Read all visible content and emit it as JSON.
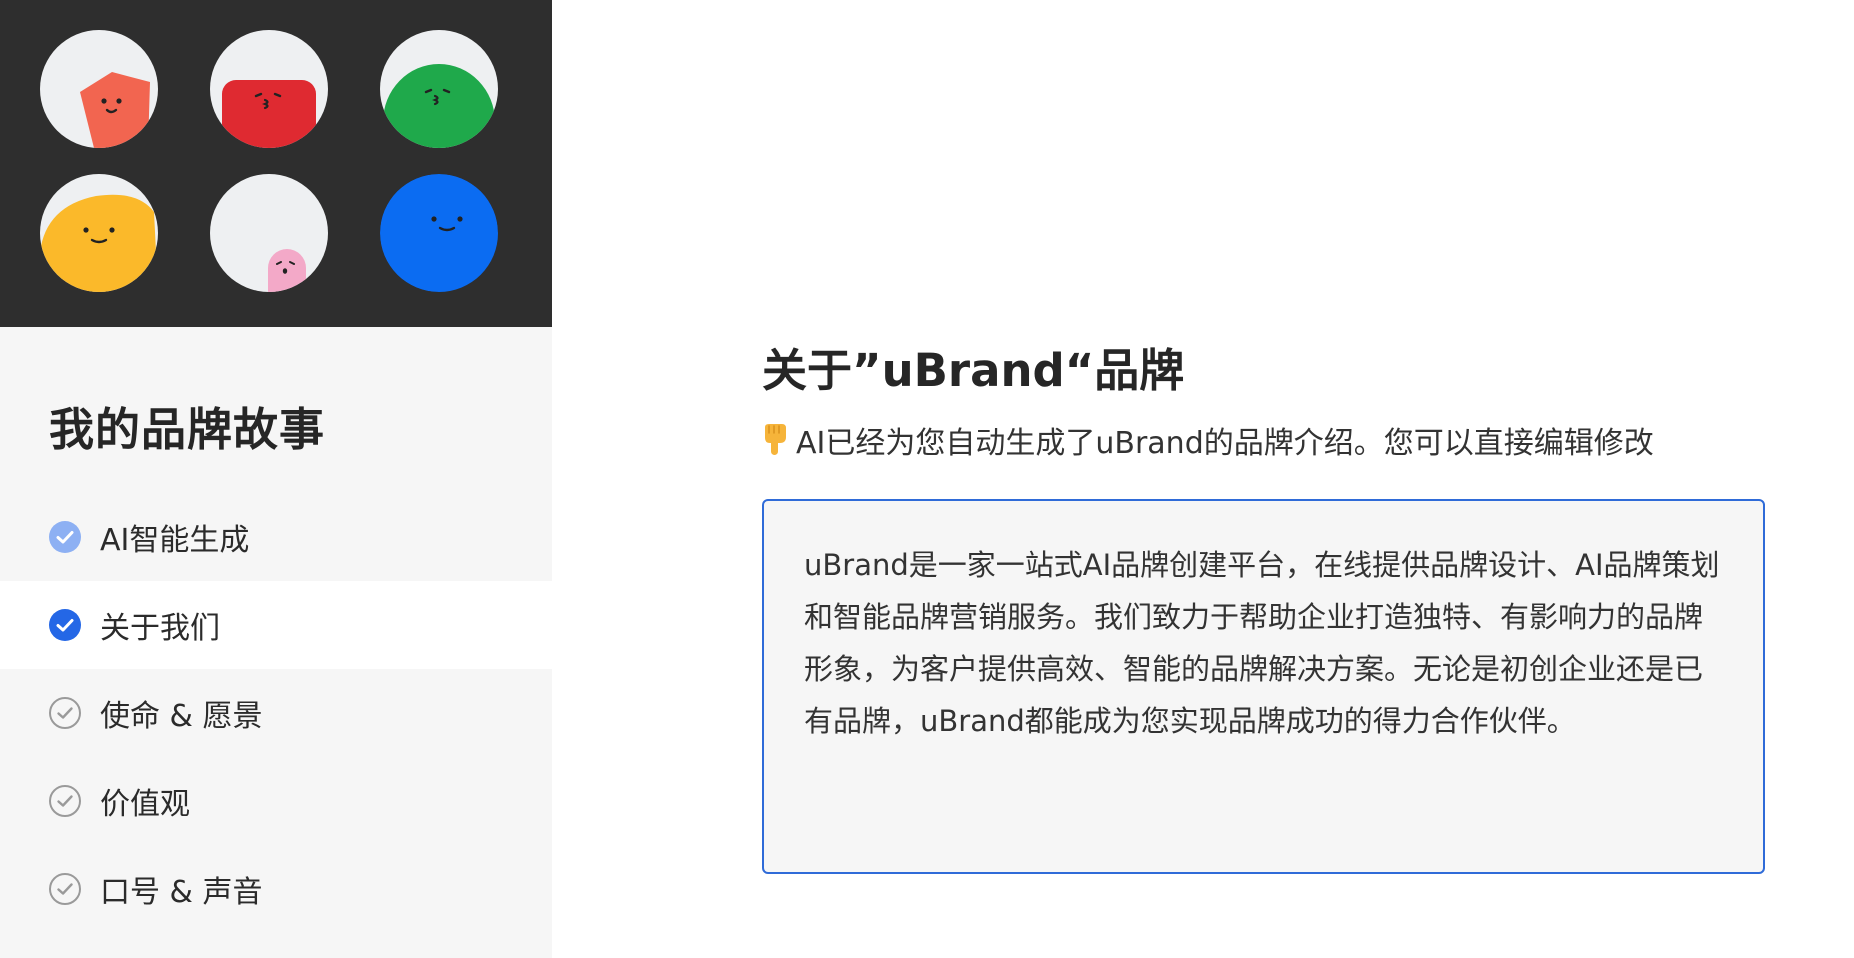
{
  "sidebar": {
    "title": "我的品牌故事",
    "items": [
      {
        "label": "AI智能生成",
        "state": "done"
      },
      {
        "label": "关于我们",
        "state": "active"
      },
      {
        "label": "使命 & 愿景",
        "state": "pending"
      },
      {
        "label": "价值观",
        "state": "pending"
      },
      {
        "label": "口号 & 声音",
        "state": "pending"
      }
    ]
  },
  "main": {
    "title": "关于”uBrand“品牌",
    "hint_icon": "pointing-down-hand-icon",
    "hint": "AI已经为您自动生成了uBrand的品牌介绍。您可以直接编辑修改",
    "description": "uBrand是一家一站式AI品牌创建平台，在线提供品牌设计、AI品牌策划和智能品牌营销服务。我们致力于帮助企业打造独特、有影响力的品牌形象，为客户提供高效、智能的品牌解决方案。无论是初创企业还是已有品牌，uBrand都能成为您实现品牌成功的得力合作伙伴。"
  },
  "colors": {
    "hero_bg": "#2e2e2e",
    "sidebar_bg": "#f6f6f6",
    "accent": "#2467e6",
    "done_check": "#8db0f3",
    "editor_border": "#2f6bd8",
    "mascot_coral": "#f26550",
    "mascot_red": "#df2a31",
    "mascot_green": "#1fa94b",
    "mascot_yellow": "#fbb92a",
    "mascot_pink": "#f3a9c8",
    "mascot_blue": "#0b6cf2"
  }
}
